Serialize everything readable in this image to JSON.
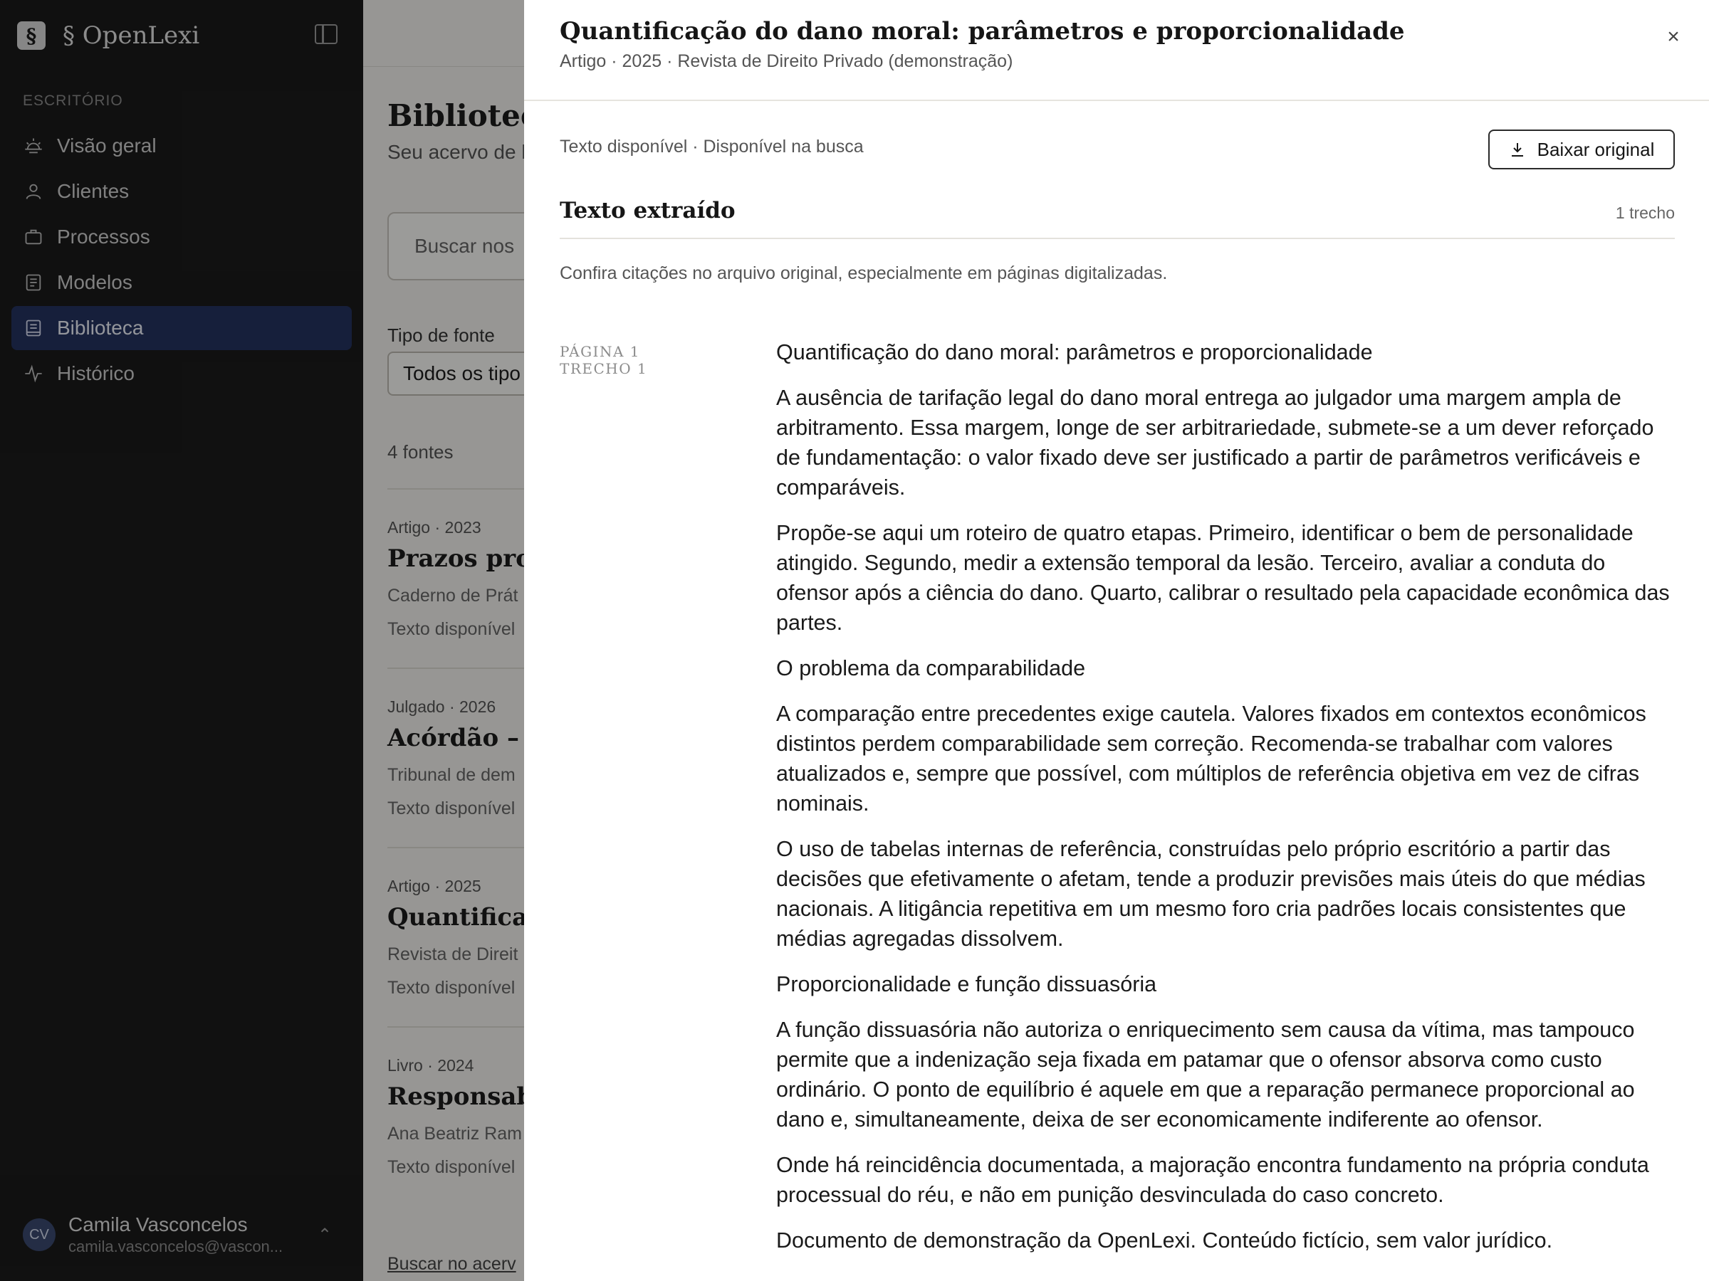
{
  "sidebar": {
    "brand_logo": "§",
    "brand_name": "§ OpenLexi",
    "section_label": "ESCRITÓRIO",
    "items": [
      {
        "label": "Visão geral",
        "icon": "sun-icon"
      },
      {
        "label": "Clientes",
        "icon": "user-icon"
      },
      {
        "label": "Processos",
        "icon": "briefcase-icon"
      },
      {
        "label": "Modelos",
        "icon": "template-icon"
      },
      {
        "label": "Biblioteca",
        "icon": "book-icon",
        "active": true
      },
      {
        "label": "Histórico",
        "icon": "activity-icon"
      }
    ],
    "user": {
      "initials": "CV",
      "name": "Camila Vasconcelos",
      "email": "camila.vasconcelos@vascon..."
    }
  },
  "main": {
    "title": "Biblioteca",
    "subtitle": "Seu acervo de l",
    "search_placeholder": "Buscar nos",
    "filter_label": "Tipo de fonte",
    "filter_value": "Todos os tipo",
    "count": "4 fontes",
    "items": [
      {
        "meta": "Artigo · 2023",
        "title": "Prazos proces",
        "source": "Caderno de Prát",
        "status": "Texto disponível"
      },
      {
        "meta": "Julgado · 2026",
        "title": "Acórdão – Ap",
        "source": "Tribunal de dem",
        "status": "Texto disponível"
      },
      {
        "meta": "Artigo · 2025",
        "title": "Quantificação",
        "source": "Revista de Direit",
        "status": "Texto disponível"
      },
      {
        "meta": "Livro · 2024",
        "title": "Responsabilid",
        "source": "Ana Beatriz Ram",
        "status": "Texto disponível"
      }
    ],
    "bottom_link": "Buscar no acerv"
  },
  "drawer": {
    "title": "Quantificação do dano moral: parâmetros e proporcionalidade",
    "subtitle": "Artigo · 2025 · Revista de Direito Privado (demonstração)",
    "close_glyph": "×",
    "status": "Texto disponível · Disponível na busca",
    "download_label": "Baixar original",
    "section_title": "Texto extraído",
    "section_count": "1 trecho",
    "notice": "Confira citações no arquivo original, especialmente em páginas digitalizadas.",
    "excerpt": {
      "page_label": "PÁGINA 1",
      "chunk_label": "TRECHO 1",
      "paragraphs": [
        "Quantificação do dano moral: parâmetros e proporcionalidade",
        "A ausência de tarifação legal do dano moral entrega ao julgador uma margem ampla de arbitramento. Essa margem, longe de ser arbitrariedade, submete-se a um dever reforçado de fundamentação: o valor fixado deve ser justificado a partir de parâmetros verificáveis e comparáveis.",
        "Propõe-se aqui um roteiro de quatro etapas. Primeiro, identificar o bem de personalidade atingido. Segundo, medir a extensão temporal da lesão. Terceiro, avaliar a conduta do ofensor após a ciência do dano. Quarto, calibrar o resultado pela capacidade econômica das partes.",
        "O problema da comparabilidade",
        "A comparação entre precedentes exige cautela. Valores fixados em contextos econômicos distintos perdem comparabilidade sem correção. Recomenda-se trabalhar com valores atualizados e, sempre que possível, com múltiplos de referência objetiva em vez de cifras nominais.",
        "O uso de tabelas internas de referência, construídas pelo próprio escritório a partir das decisões que efetivamente o afetam, tende a produzir previsões mais úteis do que médias nacionais. A litigância repetitiva em um mesmo foro cria padrões locais consistentes que médias agregadas dissolvem.",
        "Proporcionalidade e função dissuasória",
        "A função dissuasória não autoriza o enriquecimento sem causa da vítima, mas tampouco permite que a indenização seja fixada em patamar que o ofensor absorva como custo ordinário. O ponto de equilíbrio é aquele em que a reparação permanece proporcional ao dano e, simultaneamente, deixa de ser economicamente indiferente ao ofensor.",
        "Onde há reincidência documentada, a majoração encontra fundamento na própria conduta processual do réu, e não em punição desvinculada do caso concreto.",
        "Documento de demonstração da OpenLexi. Conteúdo fictício, sem valor jurídico."
      ]
    }
  }
}
